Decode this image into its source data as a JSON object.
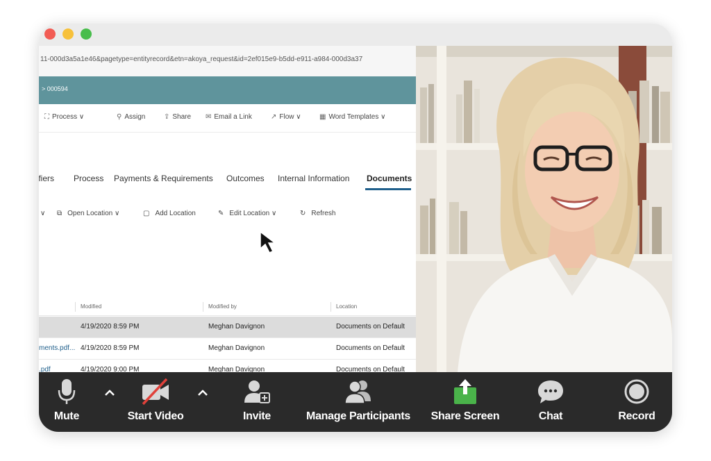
{
  "browser": {
    "url": "11-000d3a5a1e46&pagetype=entityrecord&etn=akoya_request&id=2ef015e9-b5dd-e911-a984-000d3a37"
  },
  "app": {
    "breadcrumb": "> 000594",
    "commands": [
      {
        "icon": "process-icon",
        "label": "Process ∨"
      },
      {
        "icon": "assign-icon",
        "label": "Assign"
      },
      {
        "icon": "share-icon",
        "label": "Share"
      },
      {
        "icon": "email-link-icon",
        "label": "Email a Link"
      },
      {
        "icon": "flow-icon",
        "label": "Flow ∨"
      },
      {
        "icon": "word-templates-icon",
        "label": "Word Templates ∨"
      }
    ],
    "tabs": [
      "lifiers",
      "Process",
      "Payments & Requirements",
      "Outcomes",
      "Internal Information",
      "Documents"
    ],
    "subcommands": [
      {
        "icon": "open-location-icon",
        "label": "Open Location ∨"
      },
      {
        "icon": "add-location-icon",
        "label": "Add Location"
      },
      {
        "icon": "edit-location-icon",
        "label": "Edit Location ∨"
      },
      {
        "icon": "refresh-icon",
        "label": "Refresh"
      }
    ],
    "table": {
      "headers": [
        "Modified",
        "Modified by",
        "Location"
      ],
      "rows": [
        {
          "name": "",
          "modified": "4/19/2020 8:59 PM",
          "modified_by": "Meghan Davignon",
          "location": "Documents on Default"
        },
        {
          "name": "ments.pdf...",
          "modified": "4/19/2020 8:59 PM",
          "modified_by": "Meghan Davignon",
          "location": "Documents on Default"
        },
        {
          "name": ".pdf",
          "modified": "4/19/2020 9:00 PM",
          "modified_by": "Meghan Davignon",
          "location": "Documents on Default"
        }
      ]
    }
  },
  "toolbar": {
    "mute_label": "Mute",
    "start_video_label": "Start Video",
    "invite_label": "Invite",
    "manage_participants_label": "Manage Participants",
    "share_screen_label": "Share Screen",
    "chat_label": "Chat",
    "record_label": "Record"
  },
  "colors": {
    "accent_teal": "#5f949c",
    "share_green": "#4ab34a",
    "toolbar_bg": "#2a2a2a",
    "video_off_red": "#e0413a"
  }
}
